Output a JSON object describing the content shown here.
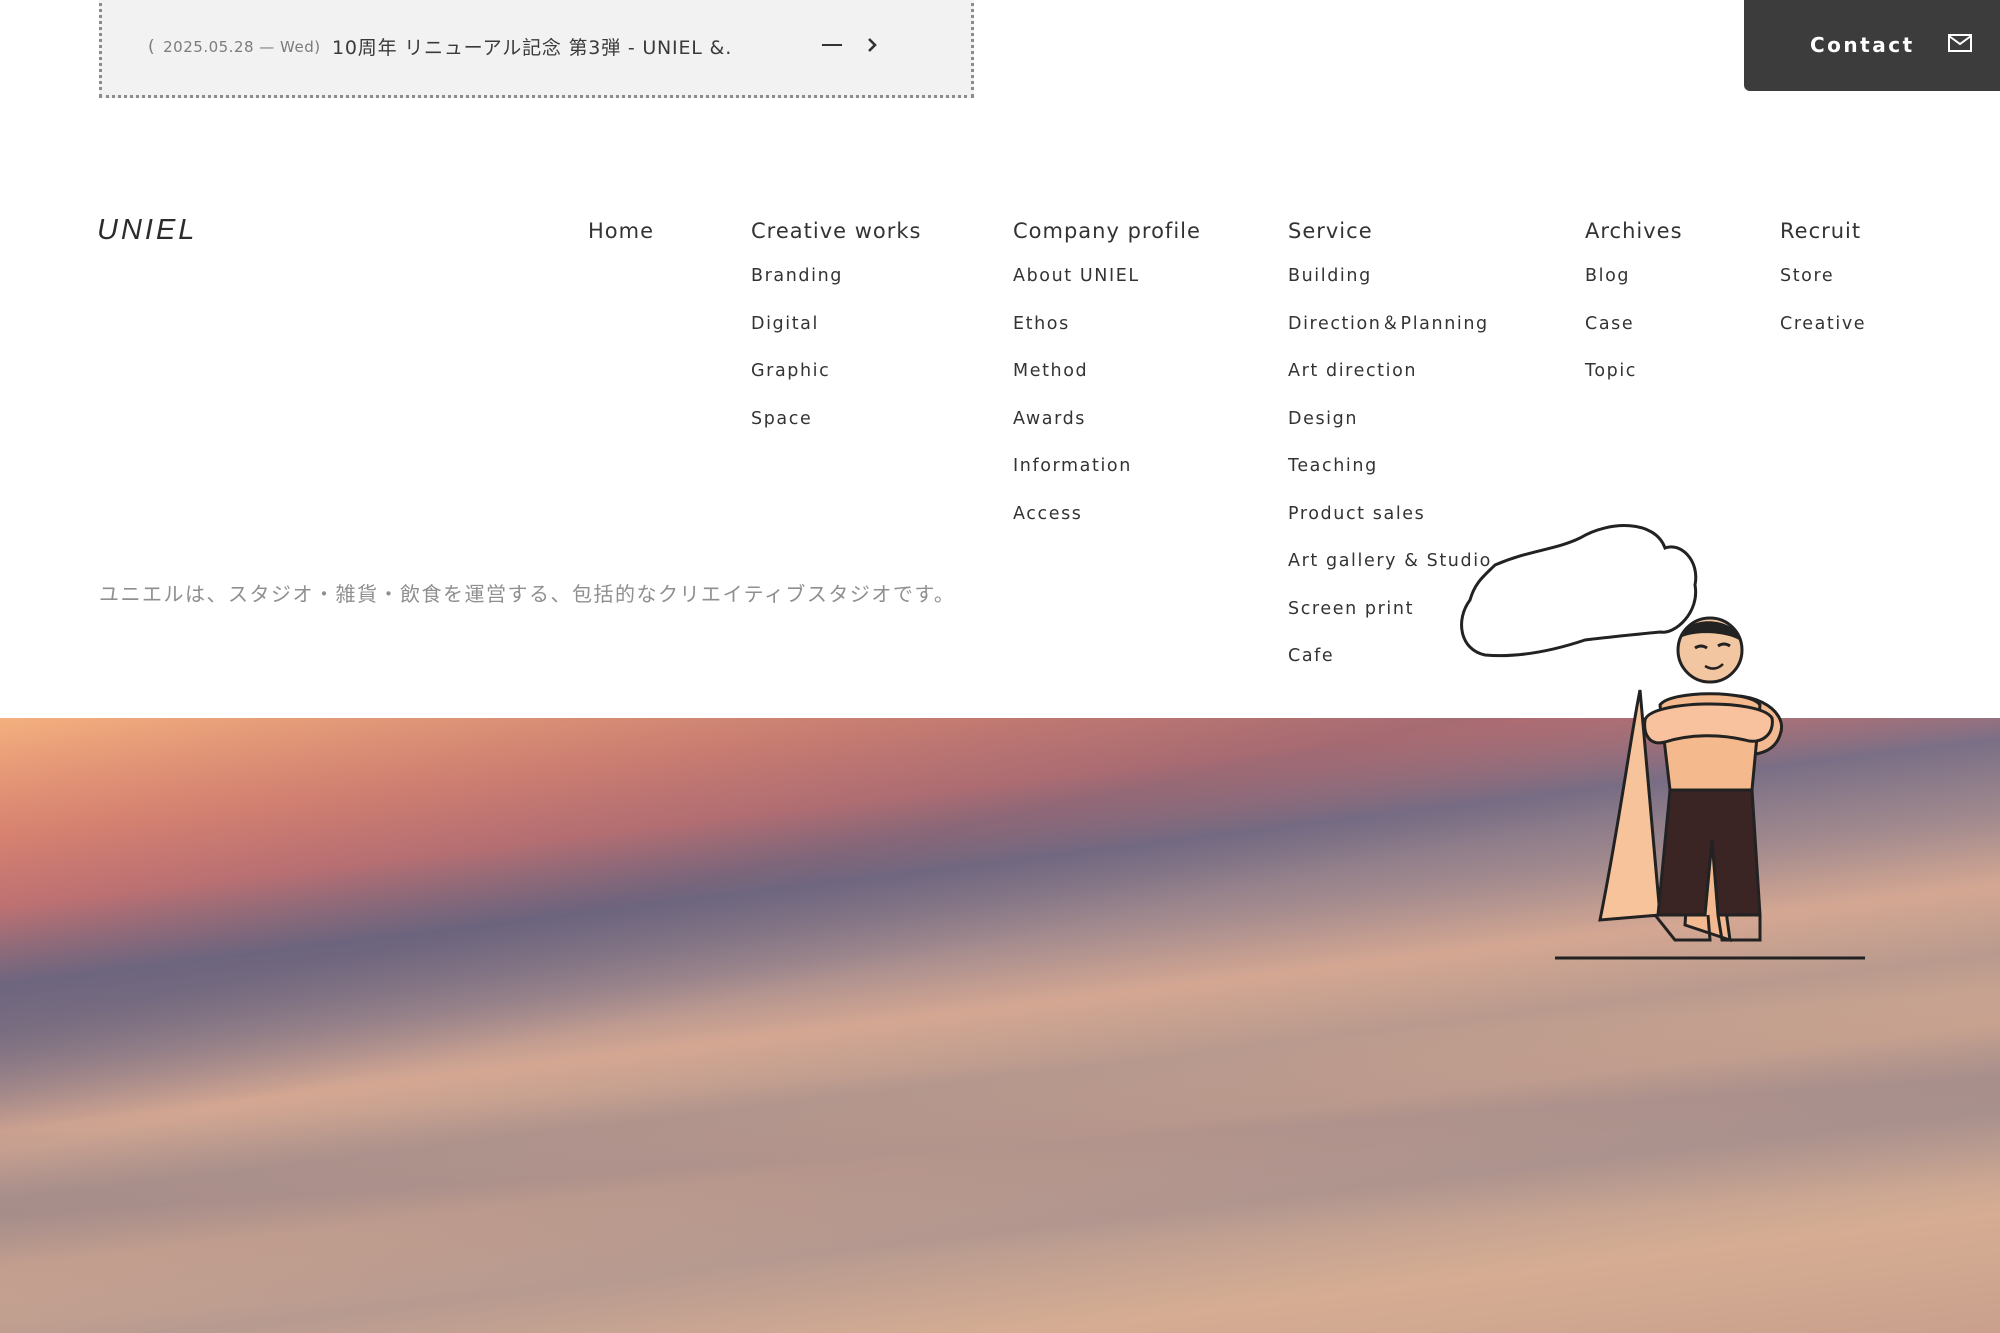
{
  "news": {
    "date": "2025.05.28 — Wed)",
    "date_open": "(",
    "title": "10周年 リニューアル記念 第3弾 - UNIEL &…"
  },
  "contact": {
    "label": "Contact",
    "icon": "mail-icon"
  },
  "footer": {
    "logo": "UNIEL",
    "tagline": "ユニエルは、スタジオ・雑貨・飲食を運営する、包括的なクリエイティブスタジオです。",
    "nav": [
      {
        "heading": "Home",
        "items": []
      },
      {
        "heading": "Creative works",
        "items": [
          "Branding",
          "Digital",
          "Graphic",
          "Space"
        ]
      },
      {
        "heading": "Company profile",
        "items": [
          "About UNIEL",
          "Ethos",
          "Method",
          "Awards",
          "Information",
          "Access"
        ]
      },
      {
        "heading": "Service",
        "items": [
          "Building",
          "Direction＆Planning",
          "Art direction",
          "Design",
          "Teaching",
          "Product sales",
          "Art gallery & Studio",
          "Screen print",
          "Cafe"
        ]
      },
      {
        "heading": "Archives",
        "items": [
          "Blog",
          "Case",
          "Topic"
        ]
      },
      {
        "heading": "Recruit",
        "items": [
          "Store",
          "Creative"
        ]
      }
    ]
  },
  "colors": {
    "contact_bg": "#3c3c3c",
    "news_bg": "#f2f2f2",
    "sky_top": "#f4b07e",
    "sky_pink": "#f08a70",
    "sky_dusk": "#7a6f86"
  }
}
